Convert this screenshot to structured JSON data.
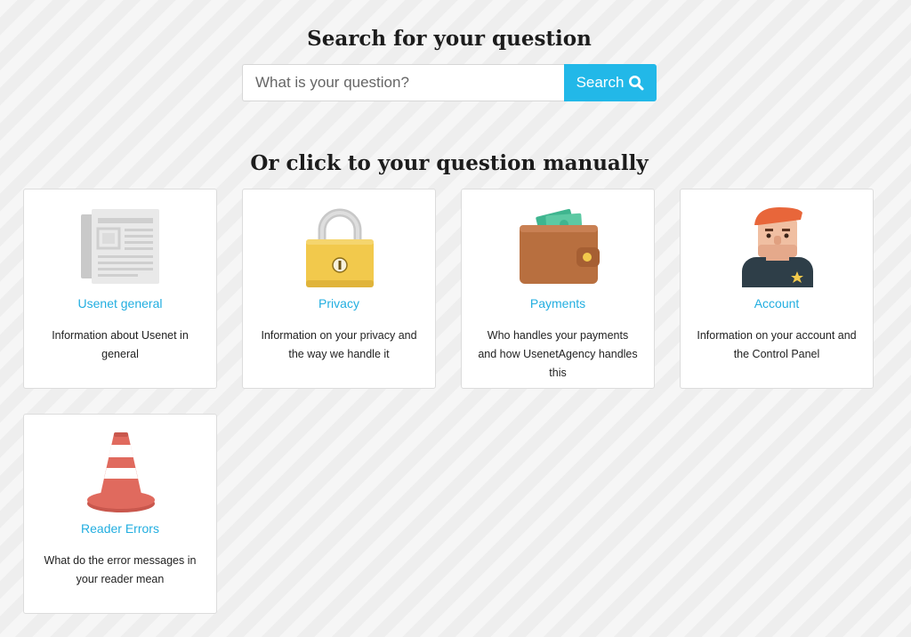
{
  "search": {
    "heading": "Search for your question",
    "placeholder": "What is your question?",
    "button_label": "Search"
  },
  "manual": {
    "heading": "Or click to your question manually"
  },
  "categories": [
    {
      "title": "Usenet general",
      "description": "Information about Usenet in general",
      "icon": "newspaper-icon"
    },
    {
      "title": "Privacy",
      "description": "Information on your privacy and the way we handle it",
      "icon": "padlock-icon"
    },
    {
      "title": "Payments",
      "description": "Who handles your payments and how UsenetAgency handles this",
      "icon": "wallet-icon"
    },
    {
      "title": "Account",
      "description": "Information on your account and the Control Panel",
      "icon": "user-avatar-icon"
    },
    {
      "title": "Reader Errors",
      "description": "What do the error messages in your reader mean",
      "icon": "traffic-cone-icon"
    }
  ],
  "colors": {
    "accent": "#22b8e8",
    "link": "#22aee0"
  }
}
